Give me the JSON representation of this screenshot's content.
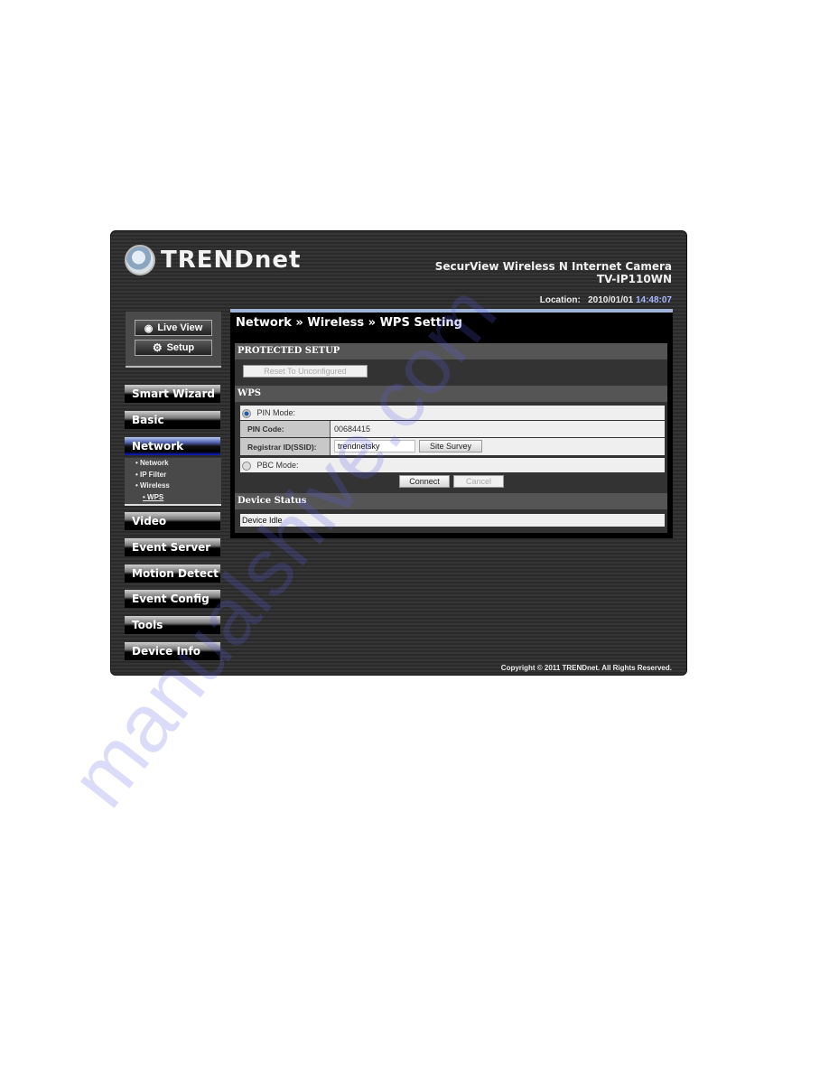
{
  "brand": {
    "logo_text": "TRENDnet"
  },
  "header": {
    "product_name": "SecurView Wireless N Internet Camera",
    "model": "TV-IP110WN",
    "location_label": "Location:",
    "date": "2010/01/01",
    "time": "14:48:07"
  },
  "top_buttons": {
    "live_view": "Live View",
    "setup": "Setup"
  },
  "sidebar": {
    "items": [
      {
        "label": "Smart Wizard"
      },
      {
        "label": "Basic"
      },
      {
        "label": "Network",
        "active": true
      },
      {
        "label": "Video"
      },
      {
        "label": "Event Server"
      },
      {
        "label": "Motion Detect"
      },
      {
        "label": "Event Config"
      },
      {
        "label": "Tools"
      },
      {
        "label": "Device Info"
      }
    ],
    "network_subitems": [
      "• Network",
      "• IP Filter",
      "• Wireless",
      "• WPS"
    ]
  },
  "main": {
    "breadcrumb": "Network » Wireless » WPS Setting",
    "protected_setup": {
      "heading": "PROTECTED SETUP",
      "reset_button": "Reset To Unconfigured"
    },
    "wps": {
      "heading": "WPS",
      "pin_mode_label": "PIN Mode:",
      "pin_mode_selected": true,
      "pin_code_label": "PIN Code:",
      "pin_code_value": "00684415",
      "registrar_label": "Registrar ID(SSID):",
      "registrar_value": "trendnetsky",
      "site_survey_button": "Site Survey",
      "pbc_mode_label": "PBC Mode:",
      "pbc_mode_selected": false,
      "connect_button": "Connect",
      "cancel_button": "Cancel"
    },
    "device_status": {
      "heading": "Device Status",
      "value": "Device Idle"
    }
  },
  "footer": {
    "copyright": "Copyright © 2011 TRENDnet. All Rights Reserved."
  },
  "watermark": "manualshive.com"
}
